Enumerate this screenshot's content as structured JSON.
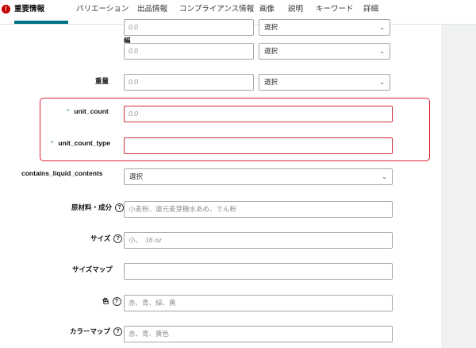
{
  "tabs": [
    {
      "label": "重要情報",
      "active": true,
      "has_alert": true
    },
    {
      "label": "バリエーション"
    },
    {
      "label": "出品情報"
    },
    {
      "label": "コンプライアンス情報"
    },
    {
      "label": "画像"
    },
    {
      "label": "説明"
    },
    {
      "label": "キーワード"
    },
    {
      "label": "詳細"
    }
  ],
  "alert_symbol": "!",
  "dimensions": {
    "width_label": "幅",
    "row1": {
      "value_placeholder": "0.0",
      "unit_value": "選択"
    },
    "row2": {
      "value_placeholder": "0.0",
      "unit_value": "選択"
    }
  },
  "weight": {
    "label": "重量",
    "value_placeholder": "0.0",
    "unit_value": "選択"
  },
  "unit_count": {
    "required_mark": "*",
    "label": "unit_count",
    "value_placeholder": "0.0"
  },
  "unit_count_type": {
    "required_mark": "*",
    "label": "unit_count_type",
    "value": ""
  },
  "contains_liquid_contents": {
    "label": "contains_liquid_contents",
    "value": "選択"
  },
  "ingredients": {
    "label": "原材料・成分",
    "placeholder": "小麦粉、還元麦芽糖水あめ、でん粉"
  },
  "size": {
    "label": "サイズ",
    "placeholder_a": "小、",
    "placeholder_b": "16 oz"
  },
  "size_map": {
    "label": "サイズマップ",
    "value": ""
  },
  "color": {
    "label": "色",
    "placeholder": "赤、青、緑、黄"
  },
  "color_map": {
    "label": "カラーマップ",
    "placeholder": "赤、青、黄色"
  },
  "help_symbol": "?",
  "chevron_symbol": "⌄",
  "colors": {
    "accent": "#007185",
    "error": "#e0202f",
    "alert": "#c40000",
    "required": "#4a8ba8"
  }
}
